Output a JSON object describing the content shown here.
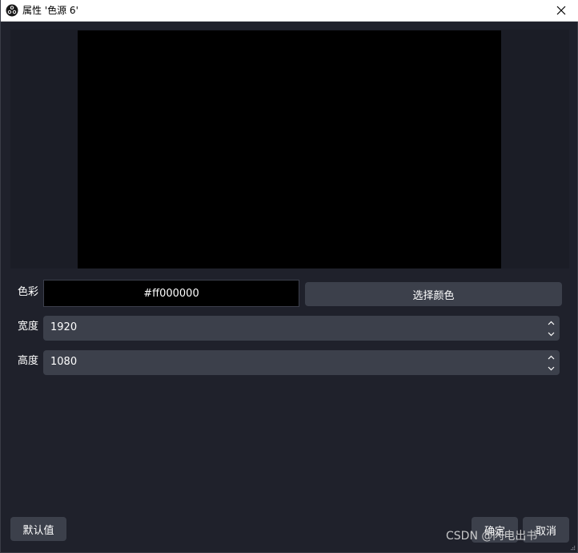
{
  "window": {
    "title": "属性 '色源 6'"
  },
  "form": {
    "color": {
      "label": "色彩",
      "value": "#ff000000",
      "pick_button": "选择颜色"
    },
    "width": {
      "label": "宽度",
      "value": "1920"
    },
    "height": {
      "label": "高度",
      "value": "1080"
    }
  },
  "footer": {
    "defaults_button": "默认值",
    "ok_button": "确定",
    "cancel_button": "取消",
    "watermark": "CSDN @闪电出书"
  },
  "colors": {
    "background": "#1f212b",
    "preview_background": "#1b1d26",
    "preview_source": "#000000",
    "control": "#3c404b",
    "titlebar": "#ffffff"
  },
  "icons": {
    "app": "obs-logo-icon",
    "close": "close-icon",
    "spin_up": "chevron-up-icon",
    "spin_down": "chevron-down-icon",
    "resize": "resize-grip-icon"
  }
}
